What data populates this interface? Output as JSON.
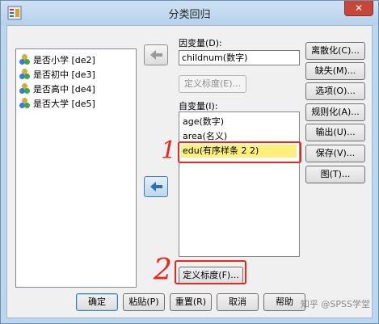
{
  "window": {
    "title": "分类回归",
    "close_glyph": "✕"
  },
  "source_list": {
    "items": [
      {
        "label": "是否小学 [de2]"
      },
      {
        "label": "是否初中 [de3]"
      },
      {
        "label": "是否高中 [de4]"
      },
      {
        "label": "是否大学 [de5]"
      }
    ]
  },
  "dependent": {
    "label": "因变量(D):",
    "value": "childnum(数字)",
    "define_scale_label": "定义标度(E)..."
  },
  "independent": {
    "label": "自变量(I):",
    "items": [
      {
        "label": "age(数字)"
      },
      {
        "label": "area(名义)"
      },
      {
        "label": "edu(有序样条 2 2)"
      }
    ],
    "define_scale_label": "定义标度(F)..."
  },
  "side_buttons": [
    {
      "label": "离散化(C)..."
    },
    {
      "label": "缺失(M)..."
    },
    {
      "label": "选项(O)..."
    },
    {
      "label": "规则化(A)..."
    },
    {
      "label": "输出(U)..."
    },
    {
      "label": "保存(V)..."
    },
    {
      "label": "图(T)..."
    }
  ],
  "bottom_buttons": {
    "ok": "确定",
    "paste": "粘贴(P)",
    "reset": "重置(R)",
    "cancel": "取消",
    "help": "帮助"
  },
  "annotations": {
    "mark1": "1",
    "mark2": "2"
  },
  "watermark": "知乎 @SPSS学堂",
  "colors": {
    "annotation": "#e8281e",
    "selection": "#fdf07a",
    "frame": "#bcd6ee"
  }
}
